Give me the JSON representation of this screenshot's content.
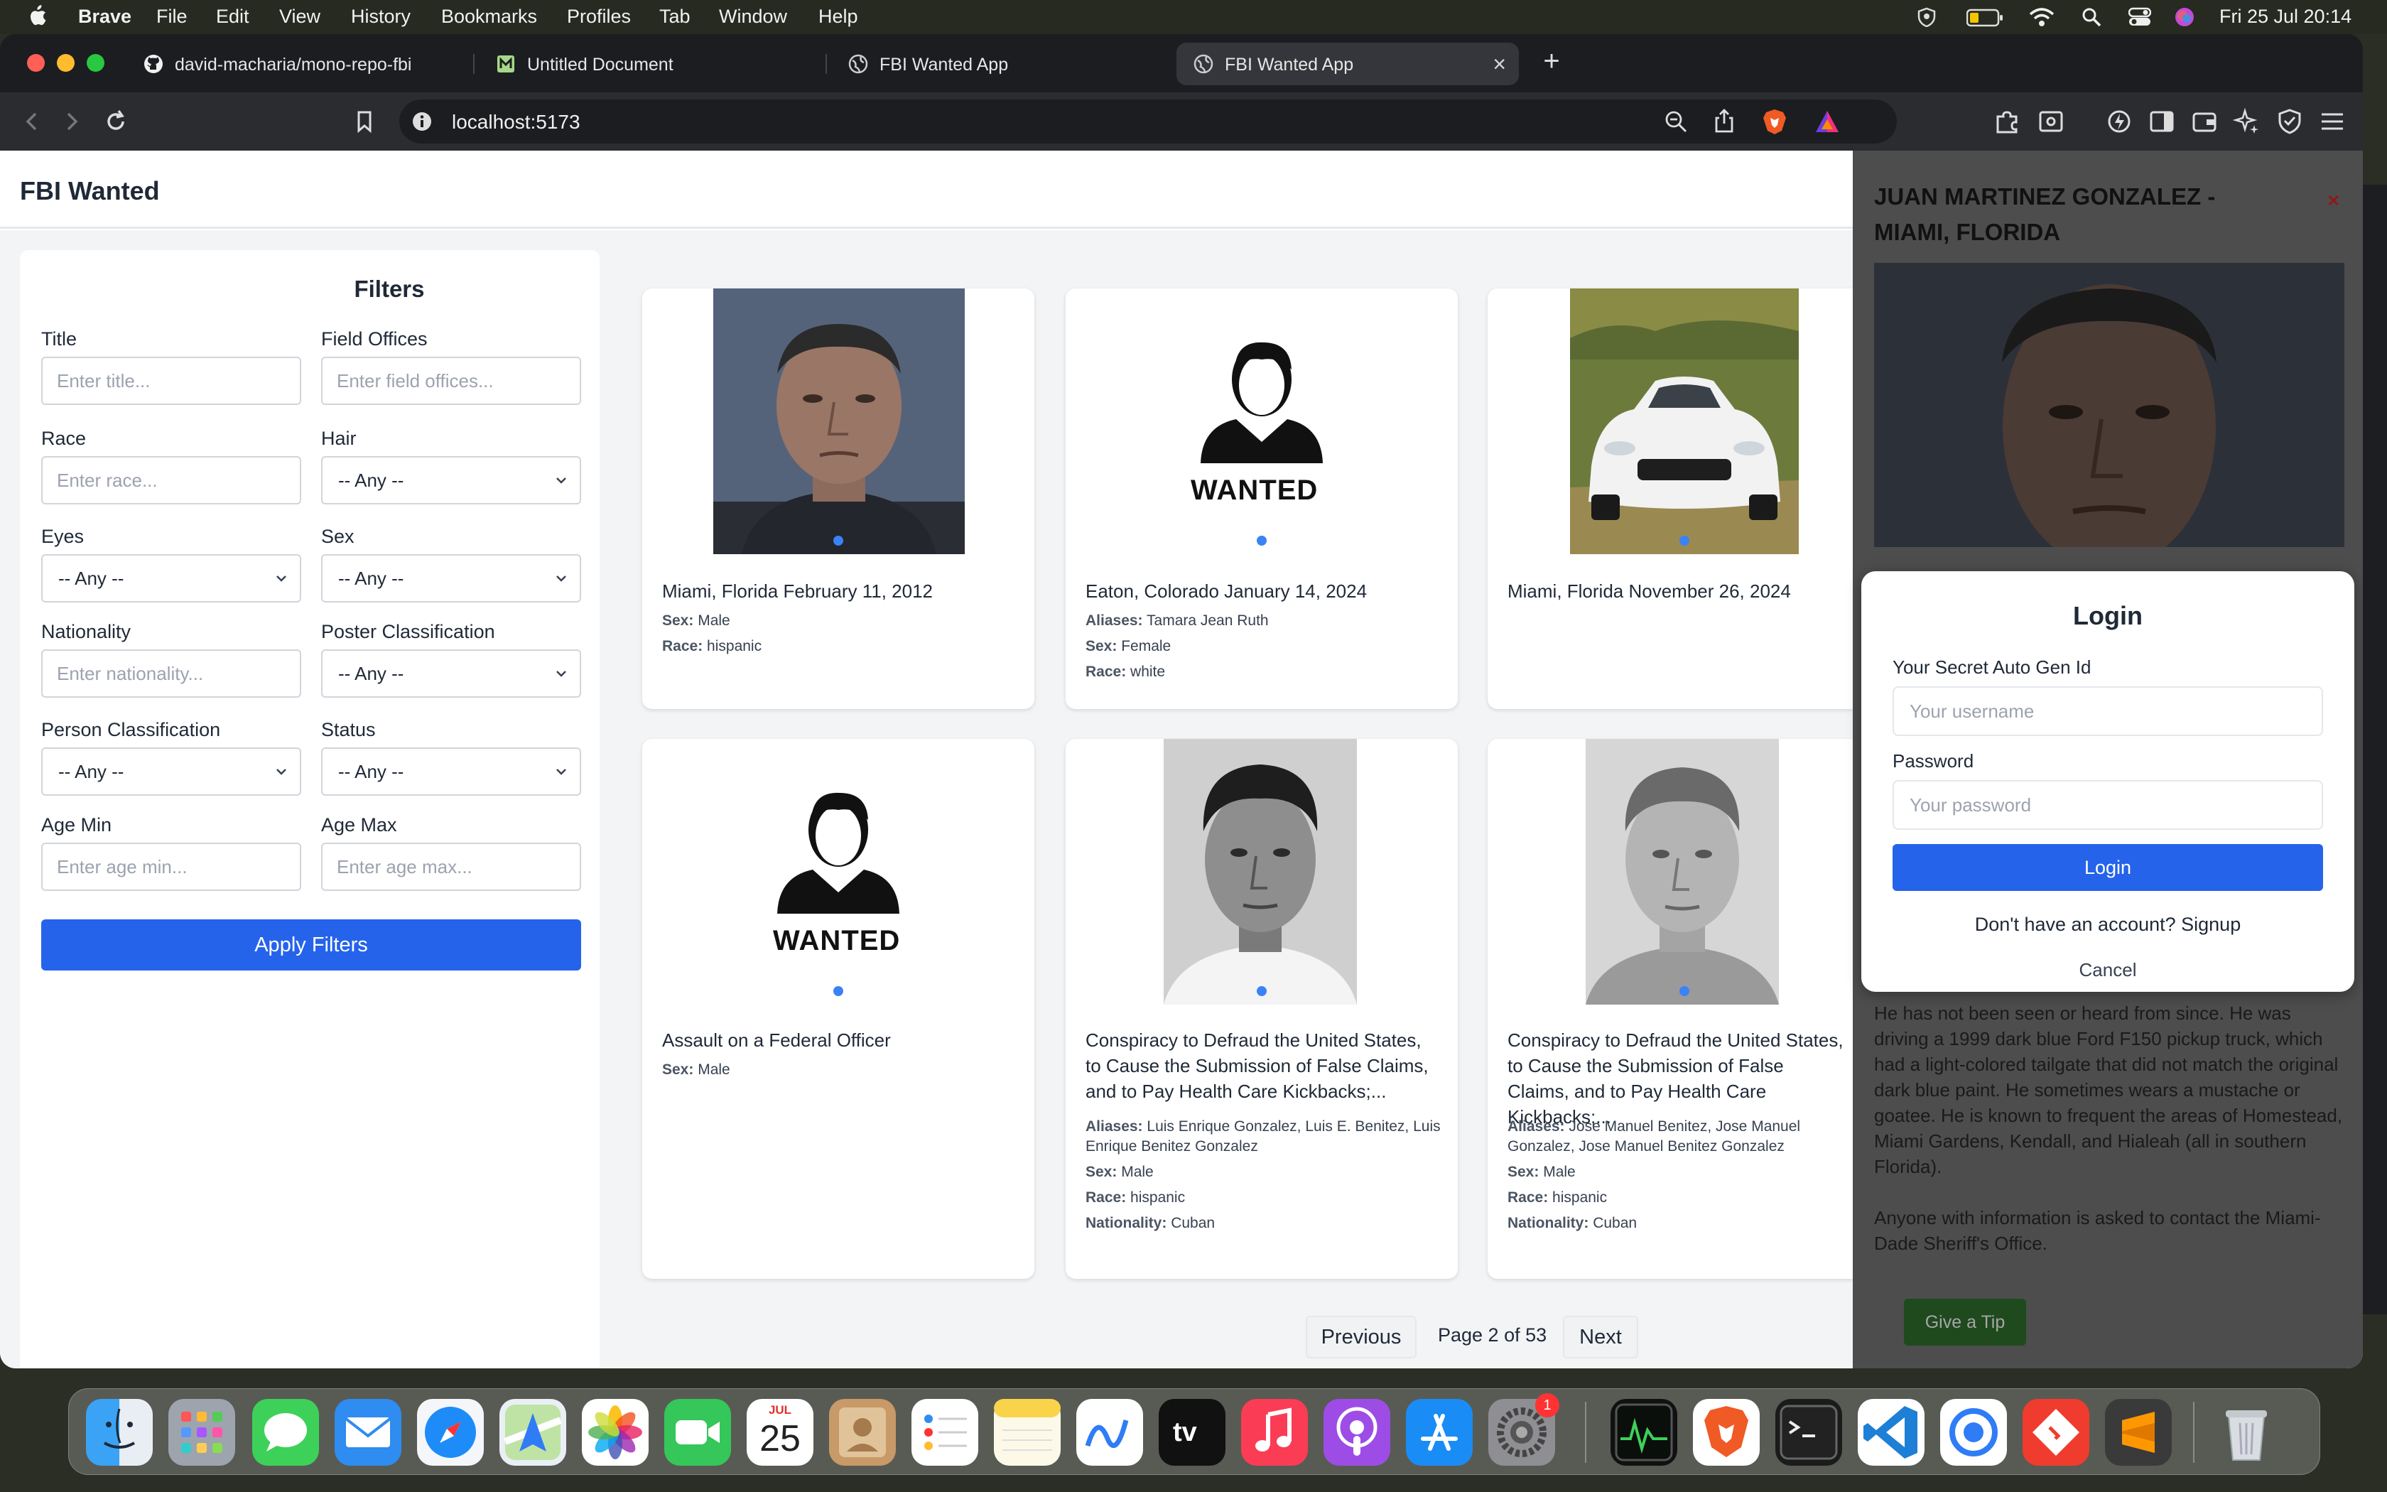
{
  "menubar": {
    "app_name": "Brave",
    "items": [
      "File",
      "Edit",
      "View",
      "History",
      "Bookmarks",
      "Profiles",
      "Tab",
      "Window",
      "Help"
    ],
    "clock": "Fri 25 Jul  20:14"
  },
  "browser": {
    "tabs": [
      {
        "title": "david-macharia/mono-repo-fbi",
        "icon": "github-icon"
      },
      {
        "title": "Untitled Document",
        "icon": "document-icon"
      },
      {
        "title": "FBI Wanted App",
        "icon": "globe-icon"
      },
      {
        "title": "FBI Wanted App",
        "icon": "globe-icon",
        "active": true
      }
    ],
    "url": "localhost:5173"
  },
  "app": {
    "title": "FBI Wanted"
  },
  "filters": {
    "heading": "Filters",
    "title_label": "Title",
    "title_placeholder": "Enter title...",
    "field_offices_label": "Field Offices",
    "field_offices_placeholder": "Enter field offices...",
    "race_label": "Race",
    "race_placeholder": "Enter race...",
    "hair_label": "Hair",
    "hair_value": "-- Any --",
    "eyes_label": "Eyes",
    "eyes_value": "-- Any --",
    "sex_label": "Sex",
    "sex_value": "-- Any --",
    "nationality_label": "Nationality",
    "nationality_placeholder": "Enter nationality...",
    "poster_label": "Poster Classification",
    "poster_value": "-- Any --",
    "person_label": "Person Classification",
    "person_value": "-- Any --",
    "status_label": "Status",
    "status_value": "-- Any --",
    "age_min_label": "Age Min",
    "age_min_placeholder": "Enter age min...",
    "age_max_label": "Age Max",
    "age_max_placeholder": "Enter age max...",
    "apply_label": "Apply Filters"
  },
  "cards": [
    {
      "title": "Miami, Florida February 11, 2012",
      "sex_label": "Sex:",
      "sex": "Male",
      "race_label": "Race:",
      "race": "hispanic"
    },
    {
      "title": "Eaton, Colorado January 14, 2024",
      "aliases_label": "Aliases:",
      "aliases": "Tamara Jean Ruth",
      "sex_label": "Sex:",
      "sex": "Female",
      "race_label": "Race:",
      "race": "white",
      "placeholder_text": "WANTED"
    },
    {
      "title": "Miami, Florida November 26, 2024"
    },
    {
      "title": "Assault on a Federal Officer",
      "sex_label": "Sex:",
      "sex": "Male",
      "placeholder_text": "WANTED"
    },
    {
      "title": "Conspiracy to Defraud the United States, to Cause the Submission of False Claims, and to Pay Health Care Kickbacks;...",
      "aliases_label": "Aliases:",
      "aliases": "Luis Enrique Gonzalez, Luis E. Benitez, Luis Enrique Benitez Gonzalez",
      "sex_label": "Sex:",
      "sex": "Male",
      "race_label": "Race:",
      "race": "hispanic",
      "nationality_label": "Nationality:",
      "nationality": "Cuban"
    },
    {
      "title": "Conspiracy to Defraud the United States, to Cause the Submission of False Claims, and to Pay Health Care Kickbacks;...",
      "aliases_label": "Aliases:",
      "aliases": "Jose Manuel Benitez, Jose Manuel Gonzalez, Jose Manuel Benitez Gonzalez",
      "sex_label": "Sex:",
      "sex": "Male",
      "race_label": "Race:",
      "race": "hispanic",
      "nationality_label": "Nationality:",
      "nationality": "Cuban"
    }
  ],
  "pagination": {
    "previous": "Previous",
    "page_info": "Page 2 of 53",
    "next": "Next"
  },
  "detail": {
    "title": "JUAN MARTINEZ GONZALEZ - MIAMI, FLORIDA",
    "close": "×",
    "desc_1": "He has not been seen or heard from since. He was driving a 1999 dark blue Ford F150 pickup truck, which had a light-colored tailgate that did not match the original dark blue paint. He sometimes wears a mustache or goatee. He is known to frequent the areas of Homestead, Miami Gardens, Kendall, and Hialeah (all in southern Florida).",
    "desc_2": "Anyone with information is asked to contact the Miami-Dade Sheriff's Office.",
    "tip_label": "Give a Tip"
  },
  "login": {
    "title": "Login",
    "id_label": "Your Secret Auto Gen Id",
    "username_placeholder": "Your username",
    "password_label": "Password",
    "password_placeholder": "Your password",
    "submit_label": "Login",
    "signup_text": "Don't have an account? Signup",
    "cancel_label": "Cancel"
  },
  "dock": {
    "calendar_month": "JUL",
    "calendar_day": "25",
    "settings_badge": "1",
    "tv_label": "tv"
  },
  "colors": {
    "primary": "#2563eb",
    "dot": "#3b82f6",
    "tip_button": "#1e4a1e"
  }
}
